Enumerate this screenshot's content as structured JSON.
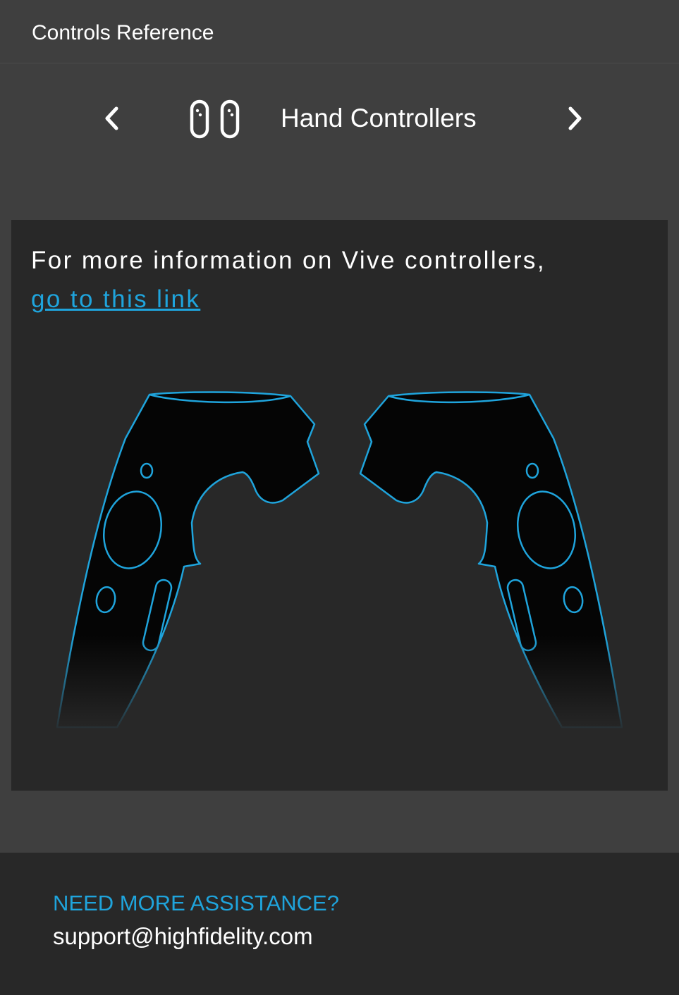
{
  "header": {
    "title": "Controls Reference"
  },
  "nav": {
    "prev_icon": "chevron-left-icon",
    "next_icon": "chevron-right-icon",
    "device_icon": "hand-controllers-icon",
    "device_title": "Hand Controllers"
  },
  "info": {
    "text": "For more information on Vive controllers,",
    "link_label": "go to this link"
  },
  "illustration": {
    "name": "vive-controllers-illustration",
    "outline_color": "#1fa4dc"
  },
  "footer": {
    "heading": "NEED MORE ASSISTANCE?",
    "email": "support@highfidelity.com"
  },
  "colors": {
    "background": "#3f3f3f",
    "panel": "#282828",
    "accent": "#1fa4dc",
    "text": "#ffffff"
  }
}
